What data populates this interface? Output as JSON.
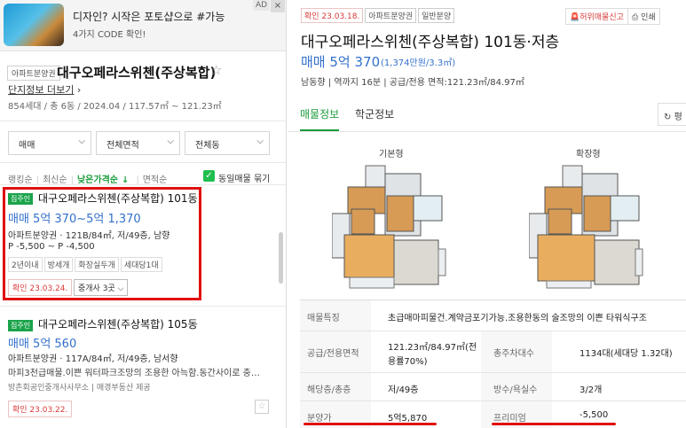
{
  "ad": {
    "title": "디자인? 시작은 포토샵으로 #가능",
    "subtitle": "4가지 CODE 확인!",
    "badge": "AD",
    "close": "×"
  },
  "complex": {
    "tag": "아파트분양권",
    "title": "대구오페라스위첸(주상복합)",
    "link": "단지정보 더보기",
    "info": "854세대 / 총 6동 / 2024.04 / 117.57㎡ ~ 121.23㎡"
  },
  "filters": {
    "trade": "매매",
    "area": "전체면적",
    "dong": "전체동"
  },
  "sorts": {
    "rank": "랭킹순",
    "recent": "최신순",
    "low_price": "낮은가격순",
    "area": "면적순",
    "same_listing": "동일매물 묶기"
  },
  "listings": [
    {
      "badge": "집주인",
      "title": "대구오페라스위첸(주상복합) 101동",
      "price": "매매 5억 370~5억 1,370",
      "line1": "아파트분양권 · 121B/84㎡, 저/49층, 남향",
      "line2": "P -5,500 ~ P -4,500",
      "tags": [
        "2년이내",
        "방세개",
        "화장실두개",
        "세대당1대"
      ],
      "confirm": "확인 23.03.24.",
      "broker": "중개사 3곳"
    },
    {
      "badge": "집주인",
      "title": "대구오페라스위첸(주상복합) 105동",
      "price": "매매 5억 560",
      "line1": "아파트분양권 · 117A/84㎡, 저/49층, 남서향",
      "line2": "마피3천급매물.이쁜 워터파크조망의 조용한 아늑함.동간사이로 충…",
      "line3": "방촌회공인중개사사무소 | 매경부동산 제공",
      "confirm": "확인 23.03.22."
    }
  ],
  "detail": {
    "tags": [
      "확인 23.03.18.",
      "아파트분양권",
      "일반분양"
    ],
    "report": "허위매물신고",
    "print": "인쇄",
    "title": "대구오페라스위첸(주상복합) 101동·저층",
    "price": "매매 5억 370",
    "price_sub": "(1,374만원/3.3㎡)",
    "info": "남동향 | 역까지 16분 | 공급/전용 면적:121.23㎡/84.97㎡",
    "tab_listing": "매물정보",
    "tab_school": "학군정보",
    "refresh": "평",
    "plan_basic": "기본형",
    "plan_extended": "확장형",
    "specs": {
      "feature_k": "매물특징",
      "feature_v": "초급매마피물건.계약금포기가능.조용한동의 술조망의 이쁜 타워식구조",
      "area_k": "공급/전용면적",
      "area_v1": "121.23㎡/84.97㎡(전",
      "area_v2": "용률70%)",
      "households_k": "총주차대수",
      "households_v": "1134대(세대당 1.32대)",
      "floor_k": "해당층/총층",
      "floor_v": "저/49층",
      "rooms_k": "방수/욕실수",
      "rooms_v": "3/2개",
      "price_k": "분양가",
      "price_v": "5억5,870",
      "premium_k": "프리미엄",
      "premium_v": "-5,500"
    }
  },
  "colors": {
    "accent_green": "#1a9c3a",
    "price_blue": "#3370cc",
    "highlight_red": "#e01010"
  }
}
